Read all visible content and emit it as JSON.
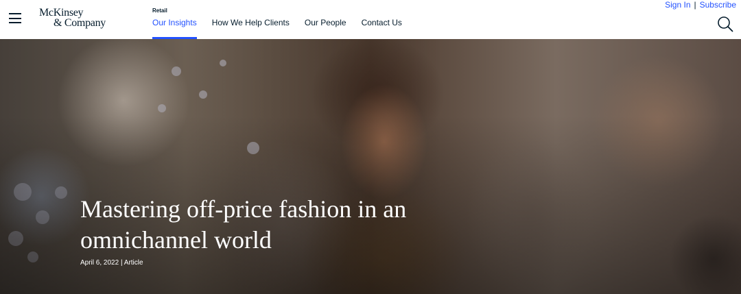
{
  "header": {
    "logo_line1": "McKinsey",
    "logo_line2": "& Company",
    "section_label": "Retail",
    "nav": [
      {
        "label": "Our Insights",
        "active": true
      },
      {
        "label": "How We Help Clients",
        "active": false
      },
      {
        "label": "Our People",
        "active": false
      },
      {
        "label": "Contact Us",
        "active": false
      }
    ],
    "account": {
      "sign_in": "Sign In",
      "separator": "|",
      "subscribe": "Subscribe"
    },
    "icons": {
      "menu": "hamburger-menu-icon",
      "search": "search-icon"
    }
  },
  "hero": {
    "title": "Mastering off-price fashion in an omnichannel world",
    "date": "April 6, 2022",
    "separator": "|",
    "type": "Article"
  },
  "colors": {
    "accent": "#2251ff",
    "text": "#051c2c"
  }
}
